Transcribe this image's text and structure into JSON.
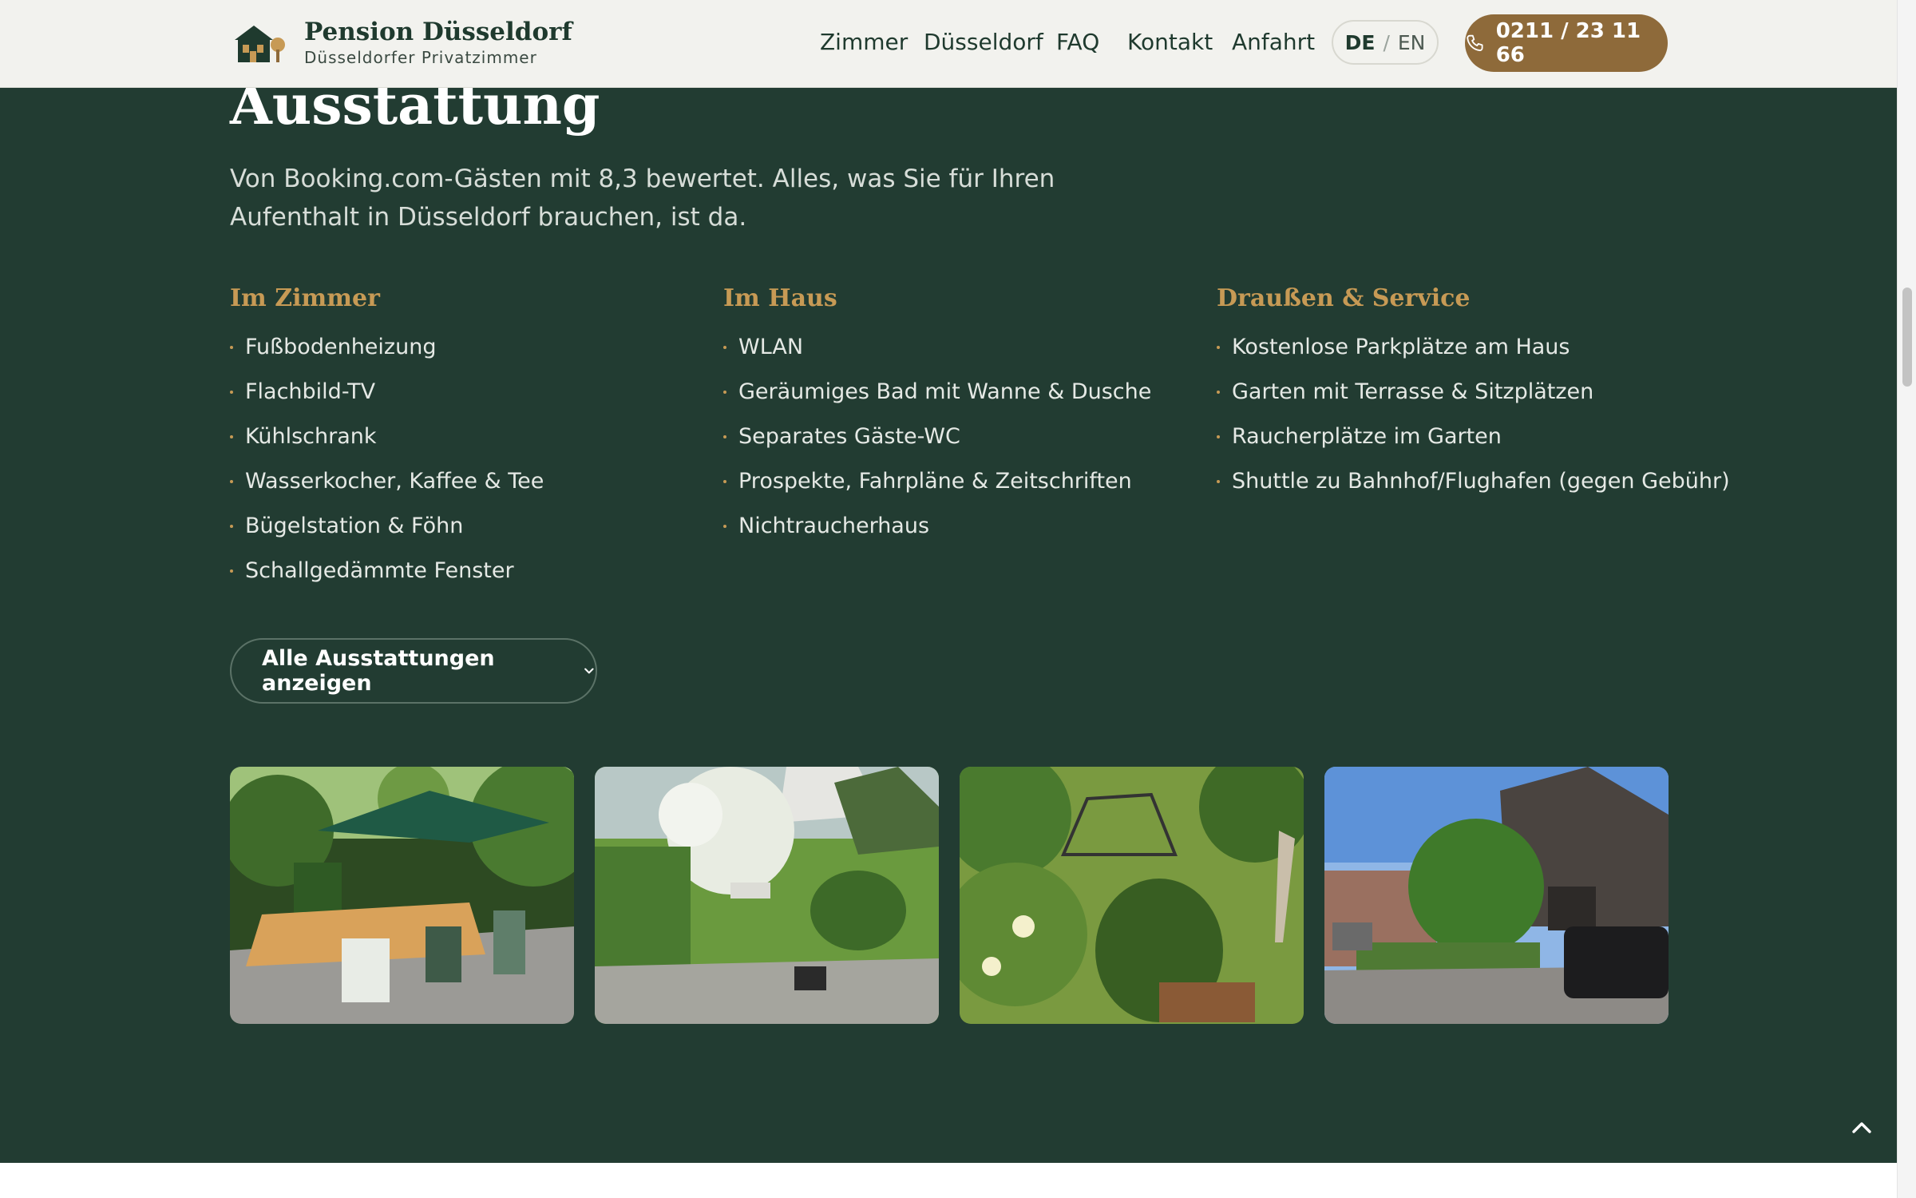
{
  "header": {
    "brand_name": "Pension Düsseldorf",
    "brand_sub": "Düsseldorfer Privatzimmer",
    "nav": [
      "Zimmer",
      "Düsseldorf",
      "FAQ",
      "Kontakt",
      "Anfahrt"
    ],
    "lang": {
      "active": "DE",
      "separator": "/",
      "inactive": "EN"
    },
    "phone": "0211 / 23 11 66"
  },
  "section": {
    "heading": "Ausstattung",
    "intro": "Von Booking.com-Gästen mit 8,3 bewertet. Alles, was Sie für Ihren Aufenthalt in Düsseldorf brauchen, ist da.",
    "columns": [
      {
        "title": "Im Zimmer",
        "items": [
          "Fußbodenheizung",
          "Flachbild-TV",
          "Kühlschrank",
          "Wasserkocher, Kaffee & Tee",
          "Bügelstation & Föhn",
          "Schallgedämmte Fenster"
        ]
      },
      {
        "title": "Im Haus",
        "items": [
          "WLAN",
          "Geräumiges Bad mit Wanne & Dusche",
          "Separates Gäste-WC",
          "Prospekte, Fahrpläne & Zeitschriften",
          "Nichtraucherhaus"
        ]
      },
      {
        "title": "Draußen & Service",
        "items": [
          "Kostenlose Parkplätze am Haus",
          "Garten mit Terrasse & Sitzplätzen",
          "Raucherplätze im Garten",
          "Shuttle zu Bahnhof/Flughafen (gegen Gebühr)"
        ]
      }
    ],
    "more_button": "Alle Ausstattungen anzeigen"
  },
  "colors": {
    "section_bg": "#223c32",
    "accent_gold": "#c79a55",
    "button_brown": "#8e6a3a",
    "header_bg": "#f2f2ee"
  },
  "icons": [
    "house-logo-icon",
    "phone-icon",
    "chevron-down-icon",
    "chevron-up-icon"
  ]
}
